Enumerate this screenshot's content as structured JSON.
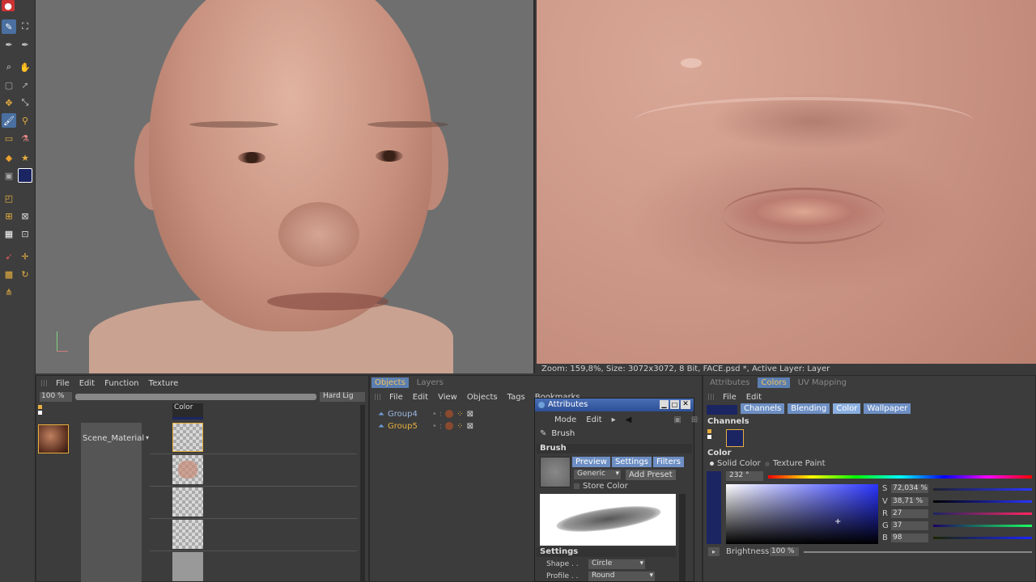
{
  "right_viewport": {
    "status": "Zoom: 159,8%, Size: 3072x3072, 8 Bit, FACE.psd *, Active Layer: Layer"
  },
  "material_panel": {
    "menu": [
      "File",
      "Edit",
      "Function",
      "Texture"
    ],
    "zoom": "100 %",
    "light_select": "Hard Lig",
    "channel_header": "Color",
    "material_name": "Scene_Material"
  },
  "objects_panel": {
    "tabs": [
      "Objects",
      "Layers"
    ],
    "active_tab": "Objects",
    "menu": [
      "File",
      "Edit",
      "View",
      "Objects",
      "Tags",
      "Bookmarks"
    ],
    "items": [
      "Group4",
      "Group5"
    ]
  },
  "attributes_window": {
    "title": "Attributes",
    "menu": [
      "Mode",
      "Edit"
    ],
    "tool_name": "Brush",
    "section_brush": "Brush",
    "subtabs": [
      "Preview",
      "Settings",
      "Filters"
    ],
    "preset_select": "Generic",
    "add_preset": "Add Preset",
    "store_color": "Store Color",
    "section_settings": "Settings",
    "shape_label": "Shape . .",
    "shape_value": "Circle",
    "profile_label": "Profile . .",
    "profile_value": "Round"
  },
  "color_panel": {
    "tabs": [
      "Attributes",
      "Colors",
      "UV Mapping"
    ],
    "active_tab": "Colors",
    "menu": [
      "File",
      "Edit"
    ],
    "subtabs": [
      "Channels",
      "Blending",
      "Color",
      "Wallpaper"
    ],
    "channels_heading": "Channels",
    "color_heading": "Color",
    "mode_solid": "Solid Color",
    "mode_texture": "Texture Paint",
    "hue": "232 °",
    "s_value": "72,034 %",
    "v_value": "38,71 %",
    "r_value": "27",
    "g_value": "37",
    "b_value": "98",
    "labels": [
      "S",
      "V",
      "R",
      "G",
      "B"
    ],
    "brightness_label": "Brightness",
    "brightness_value": "100 %",
    "current_color": "#1b2562"
  }
}
